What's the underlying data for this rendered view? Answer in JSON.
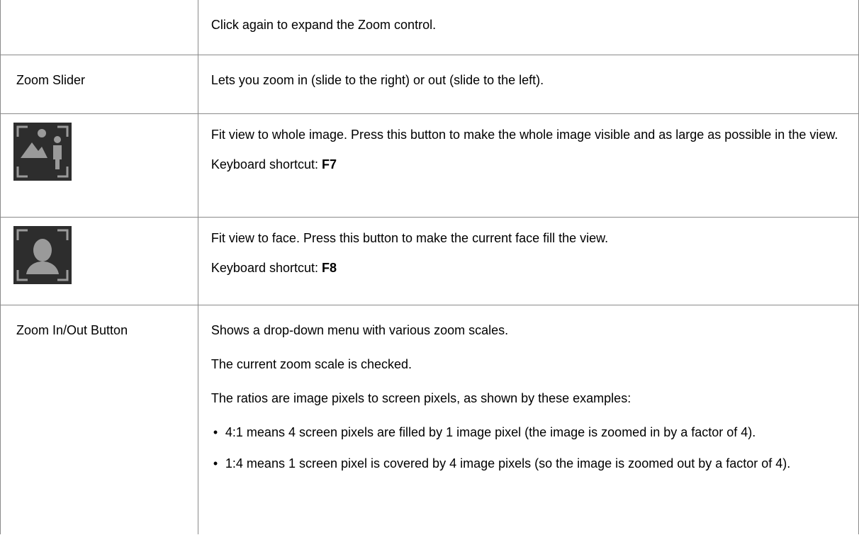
{
  "rows": {
    "expand": {
      "label": "",
      "text": "Click again to expand the Zoom control."
    },
    "zoom_slider": {
      "label": "Zoom Slider",
      "text": "Lets you zoom in (slide to the right) or out (slide to the left)."
    },
    "fit_image": {
      "icon": "fit-whole-image-icon",
      "text": "Fit view to whole image.  Press this button to make the whole image visible and as large as possible in the view.",
      "shortcut_prefix": "Keyboard shortcut: ",
      "shortcut_key": "F7"
    },
    "fit_face": {
      "icon": "fit-face-icon",
      "text": "Fit view to face.  Press this button to make the current face fill the view.",
      "shortcut_prefix": "Keyboard shortcut: ",
      "shortcut_key": "F8"
    },
    "zoom_button": {
      "label": "Zoom In/Out Button",
      "paragraphs": [
        "Shows a drop-down menu with various zoom scales.",
        "The current zoom scale is checked.",
        "The ratios are image pixels to screen pixels, as shown by these examples:"
      ],
      "bullets": [
        "4:1 means 4 screen pixels are filled by 1 image pixel (the image is zoomed in by a factor of 4).",
        "1:4 means 1 screen pixel is covered by 4 image pixels (so the image is zoomed out by a factor of 4)."
      ]
    }
  },
  "colors": {
    "border": "#8a8a8a",
    "icon_bg": "#2d2d2d",
    "icon_fg": "#9a9a9a"
  }
}
